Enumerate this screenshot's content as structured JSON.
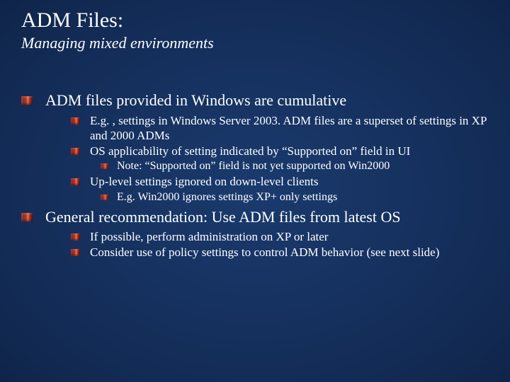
{
  "title": "ADM Files:",
  "subtitle": "Managing mixed environments",
  "body": [
    {
      "level": 1,
      "text": "ADM files provided in Windows are cumulative"
    },
    {
      "level": 2,
      "text": "E.g. , settings in Windows Server 2003. ADM files are a superset of settings in XP and 2000 ADMs"
    },
    {
      "level": 2,
      "text": "OS applicability of setting indicated by “Supported on” field in UI"
    },
    {
      "level": 3,
      "text": "Note: “Supported on” field is not yet supported on Win2000"
    },
    {
      "level": 2,
      "text": "Up-level settings ignored on down-level clients"
    },
    {
      "level": 3,
      "text": "E.g. Win2000 ignores settings XP+ only settings"
    },
    {
      "level": 1,
      "text": "General recommendation: Use ADM files from latest OS"
    },
    {
      "level": 2,
      "text": "If possible, perform administration on XP or later"
    },
    {
      "level": 2,
      "text": "Consider use of policy settings to control ADM behavior (see next slide)"
    }
  ]
}
